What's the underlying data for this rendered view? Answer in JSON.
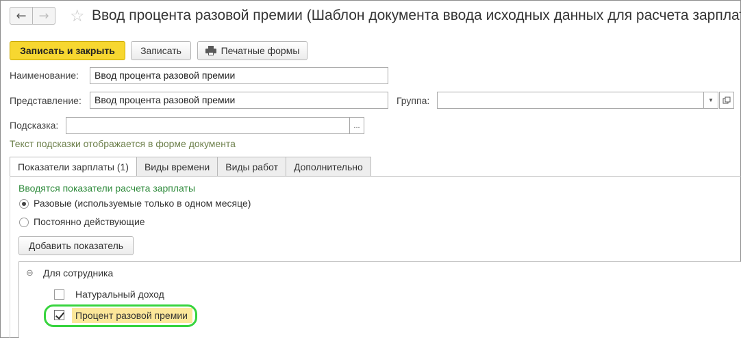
{
  "window": {
    "title": "Ввод процента разовой премии (Шаблон документа ввода исходных данных для расчета зарплаты)"
  },
  "nav": {
    "back_icon": "arrow-left-icon",
    "forward_icon": "arrow-right-icon",
    "favorite_icon": "star-icon"
  },
  "toolbar": {
    "save_close_label": "Записать и закрыть",
    "save_label": "Записать",
    "print_label": "Печатные формы",
    "primary_color": "#f7d730"
  },
  "form": {
    "name_label": "Наименование:",
    "name_value": "Ввод процента разовой премии",
    "view_label": "Представление:",
    "view_value": "Ввод процента разовой премии",
    "group_label": "Группа:",
    "group_value": "",
    "hint_label": "Подсказка:",
    "hint_value": "",
    "hint_note": "Текст подсказки отображается в форме документа"
  },
  "tabs": [
    {
      "label": "Показатели зарплаты (1)"
    },
    {
      "label": "Виды времени"
    },
    {
      "label": "Виды работ"
    },
    {
      "label": "Дополнительно"
    }
  ],
  "indicators": {
    "heading": "Вводятся показатели расчета зарплаты",
    "options": [
      {
        "label": "Разовые (используемые только в одном месяце)",
        "selected": true
      },
      {
        "label": "Постоянно действующие",
        "selected": false
      }
    ],
    "add_button": "Добавить показатель"
  },
  "tree": {
    "group_label": "Для сотрудника",
    "items": [
      {
        "label": "Натуральный доход",
        "checked": false
      },
      {
        "label": "Процент разовой премии",
        "checked": true
      }
    ],
    "highlight_color": "#37d43e"
  }
}
